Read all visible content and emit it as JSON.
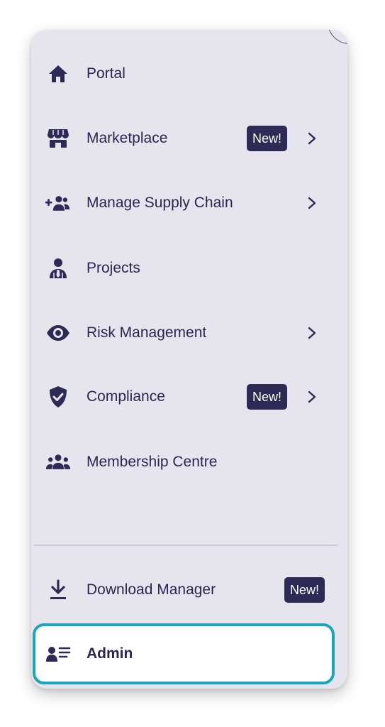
{
  "menu": {
    "items": [
      {
        "label": "Portal",
        "icon": "home-icon"
      },
      {
        "label": "Marketplace",
        "icon": "store-icon",
        "badge": "New!",
        "has_submenu": true
      },
      {
        "label": "Manage Supply Chain",
        "icon": "add-users-icon",
        "has_submenu": true
      },
      {
        "label": "Projects",
        "icon": "user-tie-icon"
      },
      {
        "label": "Risk Management",
        "icon": "eye-icon",
        "has_submenu": true
      },
      {
        "label": "Compliance",
        "icon": "shield-check-icon",
        "badge": "New!",
        "has_submenu": true
      },
      {
        "label": "Membership Centre",
        "icon": "group-icon"
      }
    ],
    "footer_items": [
      {
        "label": "Download Manager",
        "icon": "download-icon",
        "badge": "New!"
      },
      {
        "label": "Admin",
        "icon": "user-list-icon",
        "highlighted": true
      }
    ]
  },
  "colors": {
    "panel_bg": "#e6e5ee",
    "text": "#2b2650",
    "badge_bg": "#2d2a55",
    "highlight_border": "#1aa6bd"
  }
}
